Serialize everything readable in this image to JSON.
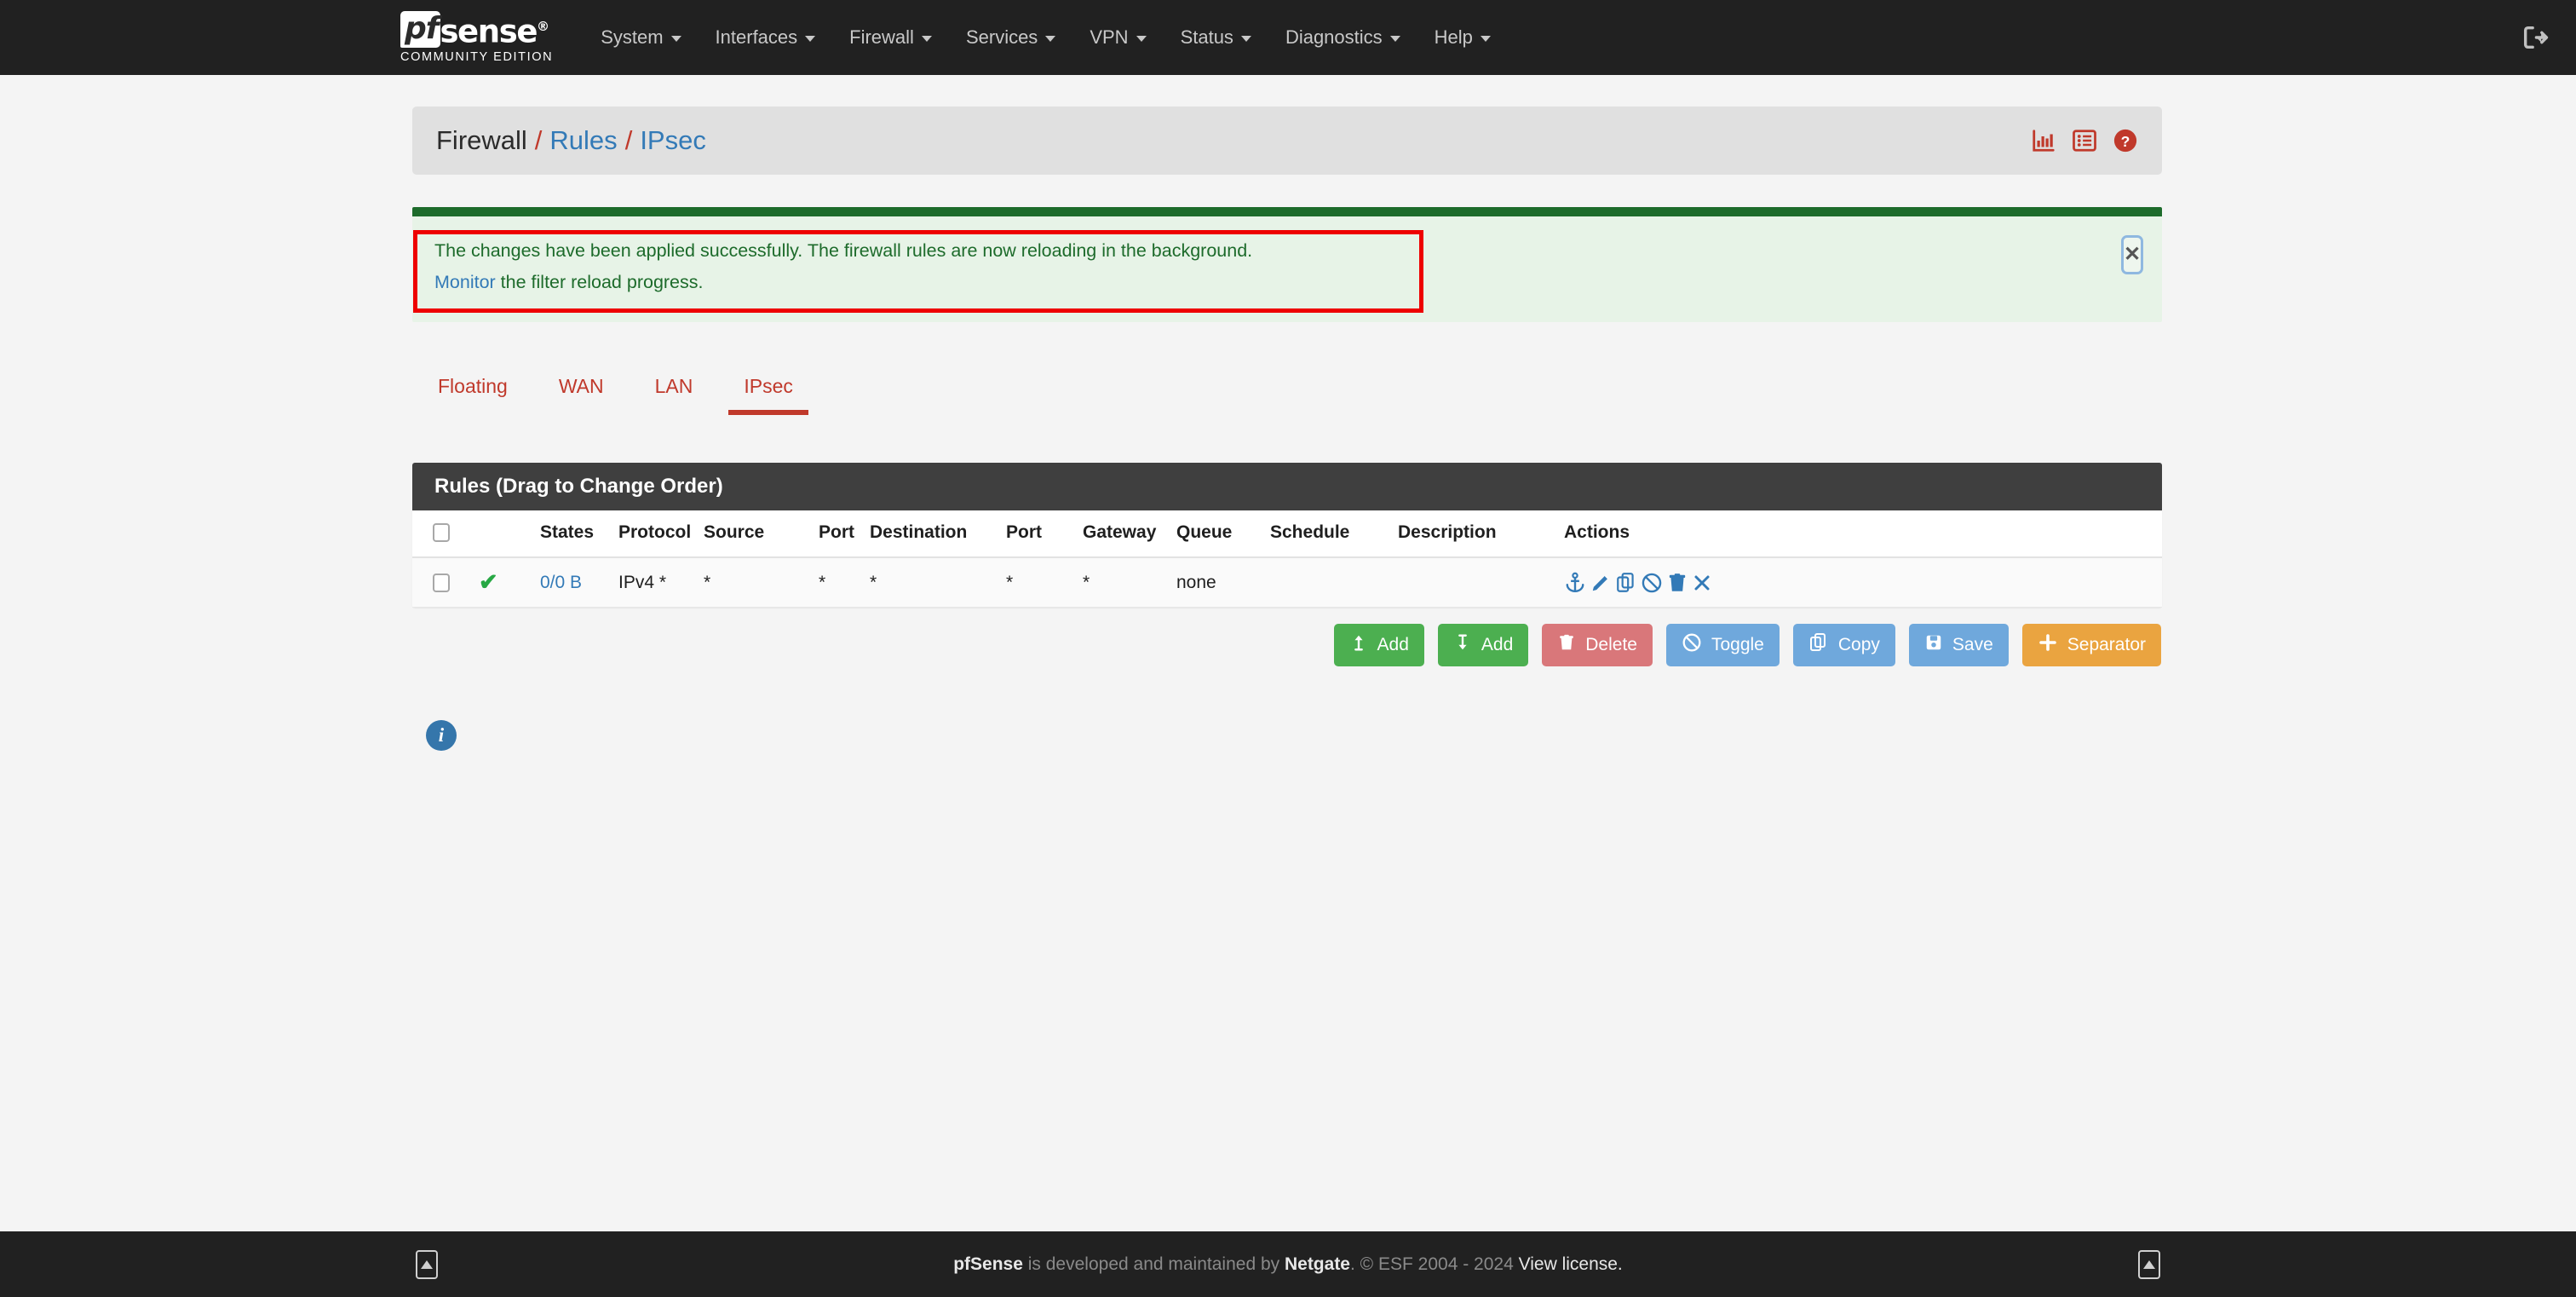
{
  "navbar": {
    "brand": {
      "pf": "pf",
      "sense": "sense",
      "reg": "®",
      "subtitle": "COMMUNITY EDITION"
    },
    "items": [
      {
        "label": "System"
      },
      {
        "label": "Interfaces"
      },
      {
        "label": "Firewall"
      },
      {
        "label": "Services"
      },
      {
        "label": "VPN"
      },
      {
        "label": "Status"
      },
      {
        "label": "Diagnostics"
      },
      {
        "label": "Help"
      }
    ],
    "logout_icon": "logout-icon"
  },
  "breadcrumb": {
    "root": "Firewall",
    "sep": "/",
    "level2": "Rules",
    "level3": "IPsec",
    "icons": [
      {
        "name": "chart-icon"
      },
      {
        "name": "list-icon"
      },
      {
        "name": "help-icon"
      }
    ]
  },
  "alert": {
    "line1": "The changes have been applied successfully. The firewall rules are now reloading in the background.",
    "link": "Monitor",
    "line2_rest": " the filter reload progress.",
    "close_label": "✕",
    "border_color": "#1d6b2b",
    "background": "#e7f3e7",
    "text_color": "#1d6b2b",
    "highlight_color": "#ee0000"
  },
  "tabs": [
    {
      "label": "Floating",
      "active": false
    },
    {
      "label": "WAN",
      "active": false
    },
    {
      "label": "LAN",
      "active": false
    },
    {
      "label": "IPsec",
      "active": true
    }
  ],
  "panel": {
    "title": "Rules (Drag to Change Order)",
    "columns": [
      "",
      "States",
      "Protocol",
      "Source",
      "Port",
      "Destination",
      "Port",
      "Gateway",
      "Queue",
      "Schedule",
      "Description",
      "Actions"
    ],
    "rows": [
      {
        "status_icon": "✔",
        "states": "0/0 B",
        "protocol": "IPv4 *",
        "source": "*",
        "port1": "*",
        "destination": "*",
        "port2": "*",
        "gateway": "*",
        "queue": "none",
        "schedule": "",
        "description": "",
        "actions": [
          "anchor-icon",
          "edit-icon",
          "copy-icon",
          "block-icon",
          "delete-icon",
          "remove-icon"
        ]
      }
    ]
  },
  "action_buttons": [
    {
      "label": "Add",
      "icon": "arrow-up-icon",
      "style": "green"
    },
    {
      "label": "Add",
      "icon": "arrow-down-icon",
      "style": "green"
    },
    {
      "label": "Delete",
      "icon": "trash-icon",
      "style": "red"
    },
    {
      "label": "Toggle",
      "icon": "ban-icon",
      "style": "blue"
    },
    {
      "label": "Copy",
      "icon": "copy-icon",
      "style": "blue"
    },
    {
      "label": "Save",
      "icon": "save-icon",
      "style": "blue"
    },
    {
      "label": "Separator",
      "icon": "plus-icon",
      "style": "orange"
    }
  ],
  "info": {
    "icon": "info-icon",
    "glyph": "i"
  },
  "footer": {
    "brand": "pfSense",
    "mid": " is developed and maintained by ",
    "netgate": "Netgate",
    "copyright": ". © ESF 2004 - 2024 ",
    "license": "View license."
  }
}
